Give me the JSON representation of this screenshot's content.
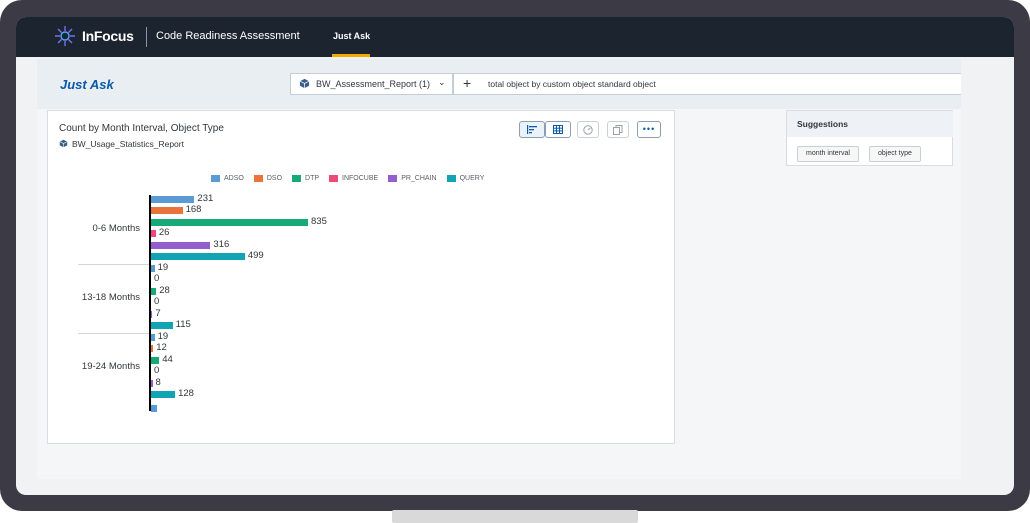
{
  "app": {
    "brand": "InFocus",
    "title": "Code Readiness Assessment",
    "active_tab": "Just Ask"
  },
  "page": {
    "title": "Just Ask",
    "model_selector": "BW_Assessment_Report (1)",
    "query": "total object by custom object standard object"
  },
  "chart_card": {
    "title": "Count by Month Interval, Object Type",
    "source": "BW_Usage_Statistics_Report",
    "toolbar_icons": [
      "bar-chart-icon",
      "table-icon",
      "gauge-icon",
      "copy-icon",
      "more-icon"
    ]
  },
  "chart_data": {
    "type": "bar",
    "orientation": "horizontal",
    "categories": [
      "0-6 Months",
      "13-18 Months",
      "19-24 Months"
    ],
    "series": [
      {
        "name": "ADSO",
        "color": "#5b9bd5",
        "values": [
          231,
          19,
          19
        ]
      },
      {
        "name": "DSO",
        "color": "#e8743b",
        "values": [
          168,
          0,
          12
        ]
      },
      {
        "name": "DTP",
        "color": "#19a979",
        "values": [
          835,
          28,
          44
        ]
      },
      {
        "name": "INFOCUBE",
        "color": "#ed4a7b",
        "values": [
          26,
          0,
          0
        ]
      },
      {
        "name": "PR_CHAIN",
        "color": "#945ecf",
        "values": [
          316,
          7,
          8
        ]
      },
      {
        "name": "QUERY",
        "color": "#13a4b4",
        "values": [
          499,
          115,
          128
        ]
      }
    ],
    "legend_position": "top",
    "grid": false
  },
  "suggestions": {
    "title": "Suggestions",
    "chips": [
      "month interval",
      "object type"
    ]
  }
}
